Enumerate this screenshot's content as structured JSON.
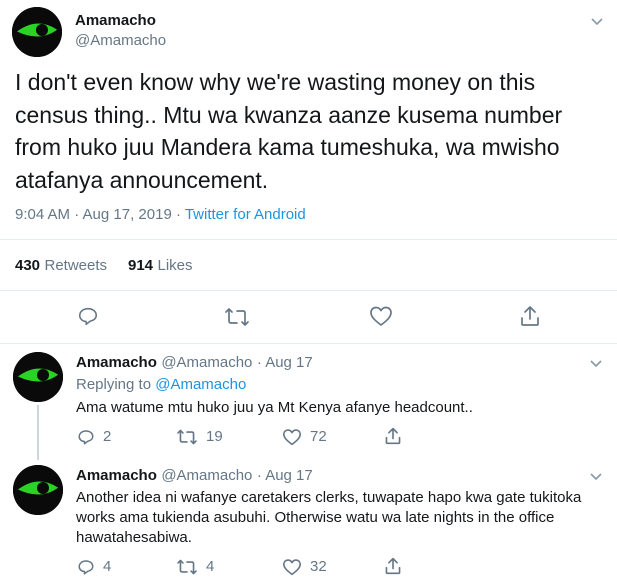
{
  "colors": {
    "accent": "#1b95e0",
    "muted": "#657786",
    "text": "#14171a",
    "divider": "#e6ecf0",
    "eye_green": "#2bd125"
  },
  "main_tweet": {
    "avatar_icon": "green-eye-avatar",
    "name": "Amamacho",
    "handle": "@Amamacho",
    "text": "I don't even know why we're wasting money on this census thing.. Mtu wa kwanza aanze kusema number from huko juu Mandera kama tumeshuka, wa mwisho atafanya announcement.",
    "timestamp": "9:04 AM · Aug 17, 2019 · ",
    "source": "Twitter for Android",
    "retweets_count": "430",
    "retweets_label": "Retweets",
    "likes_count": "914",
    "likes_label": "Likes",
    "actions": [
      "reply-icon",
      "retweet-icon",
      "like-icon",
      "share-icon"
    ]
  },
  "replies": [
    {
      "name": "Amamacho",
      "handle": "@Amamacho",
      "date": "· Aug 17",
      "replying_prefix": "Replying to ",
      "replying_to": "@Amamacho",
      "text": "Ama watume mtu huko juu ya Mt Kenya afanye headcount..",
      "reply_count": "2",
      "retweet_count": "19",
      "like_count": "72"
    },
    {
      "name": "Amamacho",
      "handle": "@Amamacho",
      "date": "· Aug 17",
      "text": "Another idea ni wafanye caretakers clerks, tuwapate hapo kwa gate tukitoka works ama tukienda asubuhi. Otherwise watu wa late nights in the office hawatahesabiwa.",
      "reply_count": "4",
      "retweet_count": "4",
      "like_count": "32"
    }
  ]
}
